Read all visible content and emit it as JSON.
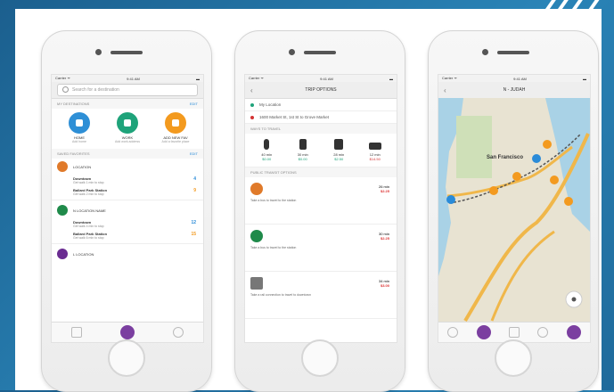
{
  "phones": [
    {
      "status": {
        "carrier": "Carrier ᯤ",
        "time": "9:41 AM",
        "battery": "▬"
      },
      "search_placeholder": "Search for a destination",
      "my_destinations_header": "MY DESTINATIONS",
      "edit_label": "EDIT",
      "favorites": [
        {
          "label": "HOME",
          "sub": "Add home",
          "color": "#2e8fd6"
        },
        {
          "label": "WORK",
          "sub": "Add work address",
          "color": "#1fa37a"
        },
        {
          "label": "ADD NEW FAV",
          "sub": "Add a favorite place",
          "color": "#f39a1f"
        }
      ],
      "routes_header": "SAVED FAVORITES",
      "routes": [
        {
          "name": "LOCATION",
          "color": "#e07a2a",
          "stops": [
            {
              "name": "Downtown",
              "sub": "Get walk 1 min to stop",
              "time": "4",
              "time_color": "#2a8bd8"
            },
            {
              "name": "Ballard Park Station",
              "sub": "Get walk 2 min to stop",
              "time": "9",
              "time_color": "#f39a1f"
            }
          ]
        },
        {
          "name": "N LOCATION NAME",
          "color": "#1f8a4a",
          "stops": [
            {
              "name": "Downtown",
              "sub": "Get walk 4 min to stop",
              "time": "12",
              "time_color": "#2a8bd8"
            },
            {
              "name": "Ballard Park Station",
              "sub": "Get walk 6 min to stop",
              "time": "15",
              "time_color": "#f39a1f"
            }
          ]
        },
        {
          "name": "L LOCATION",
          "color": "#6a2c91",
          "stops": []
        }
      ]
    },
    {
      "status": {
        "carrier": "Carrier ᯤ",
        "time": "9:41 AM",
        "battery": "▬"
      },
      "title": "TRIP OPTIONS",
      "origin": "My Location",
      "destination": "1600 Market St, 1st St to Grove Market",
      "ways_header": "WAYS TO TRAVEL",
      "modes": [
        {
          "time": "40 min",
          "cost": "$0.00",
          "cost_color": "#1fa37a"
        },
        {
          "time": "30 min",
          "cost": "$0.00",
          "cost_color": "#1fa37a"
        },
        {
          "time": "28 min",
          "cost": "$2.50",
          "cost_color": "#1fa37a"
        },
        {
          "time": "12 min",
          "cost": "$14.50",
          "cost_color": "#d33333"
        }
      ],
      "transit_header": "PUBLIC TRANSIT OPTIONS",
      "transit": [
        {
          "color": "#e07a2a",
          "text": "Take a bus to travel to the station",
          "time": "26 min",
          "price": "$2.25"
        },
        {
          "color": "#1f8a4a",
          "text": "Take a bus to travel to the station",
          "time": "30 min",
          "price": "$2.25"
        },
        {
          "color": "#777777",
          "text": "Take a rail connection to travel to downtown",
          "time": "34 min",
          "price": "$3.00"
        }
      ]
    },
    {
      "status": {
        "carrier": "Carrier ᯤ",
        "time": "9:41 AM",
        "battery": "▬"
      },
      "title": "N - JUDAH",
      "city_label": "San Francisco"
    }
  ]
}
